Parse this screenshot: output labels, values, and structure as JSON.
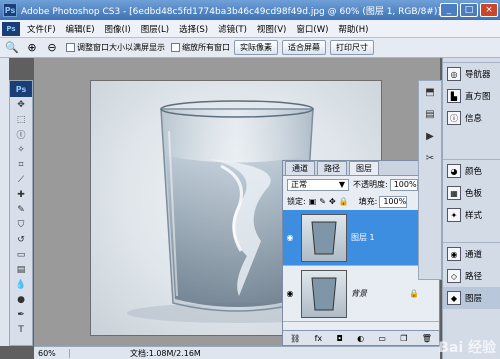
{
  "window": {
    "title": "Adobe Photoshop CS3 - [6edbd48c5fd1774ba3b46c49cd98f49d.jpg @ 60% (图层 1, RGB/8#)]",
    "app_badge": "Ps",
    "minimize": "_",
    "maximize": "□",
    "close": "×"
  },
  "menu": {
    "badge": "Ps",
    "items": [
      "文件(F)",
      "编辑(E)",
      "图像(I)",
      "图层(L)",
      "选择(S)",
      "滤镜(T)",
      "视图(V)",
      "窗口(W)",
      "帮助(H)"
    ]
  },
  "options": {
    "resize_windows_label": "调整窗口大小以满屏显示",
    "zoom_all_label": "缩放所有窗口",
    "actual_pixels": "实际像素",
    "fit_screen": "适合屏幕",
    "print_size": "打印尺寸"
  },
  "toolbox": {
    "badge": "Ps"
  },
  "status": {
    "zoom": "60%",
    "doc": "文档:1.08M/2.16M"
  },
  "layers_panel": {
    "tabs": [
      "通道",
      "路径",
      "图层"
    ],
    "active_tab": "图层",
    "blend_mode": "正常",
    "opacity_label": "不透明度:",
    "opacity_value": "100%",
    "lock_label": "锁定:",
    "fill_label": "填充:",
    "fill_value": "100%",
    "layers": [
      {
        "name": "图层 1",
        "active": true
      },
      {
        "name": "背景",
        "active": false
      }
    ]
  },
  "right_dock": {
    "group1": [
      "导航器",
      "直方图",
      "信息"
    ],
    "group2": [
      "颜色",
      "色板",
      "样式"
    ],
    "group3": [
      "通道",
      "路径",
      "图层"
    ]
  },
  "watermark": "Bai 经验"
}
